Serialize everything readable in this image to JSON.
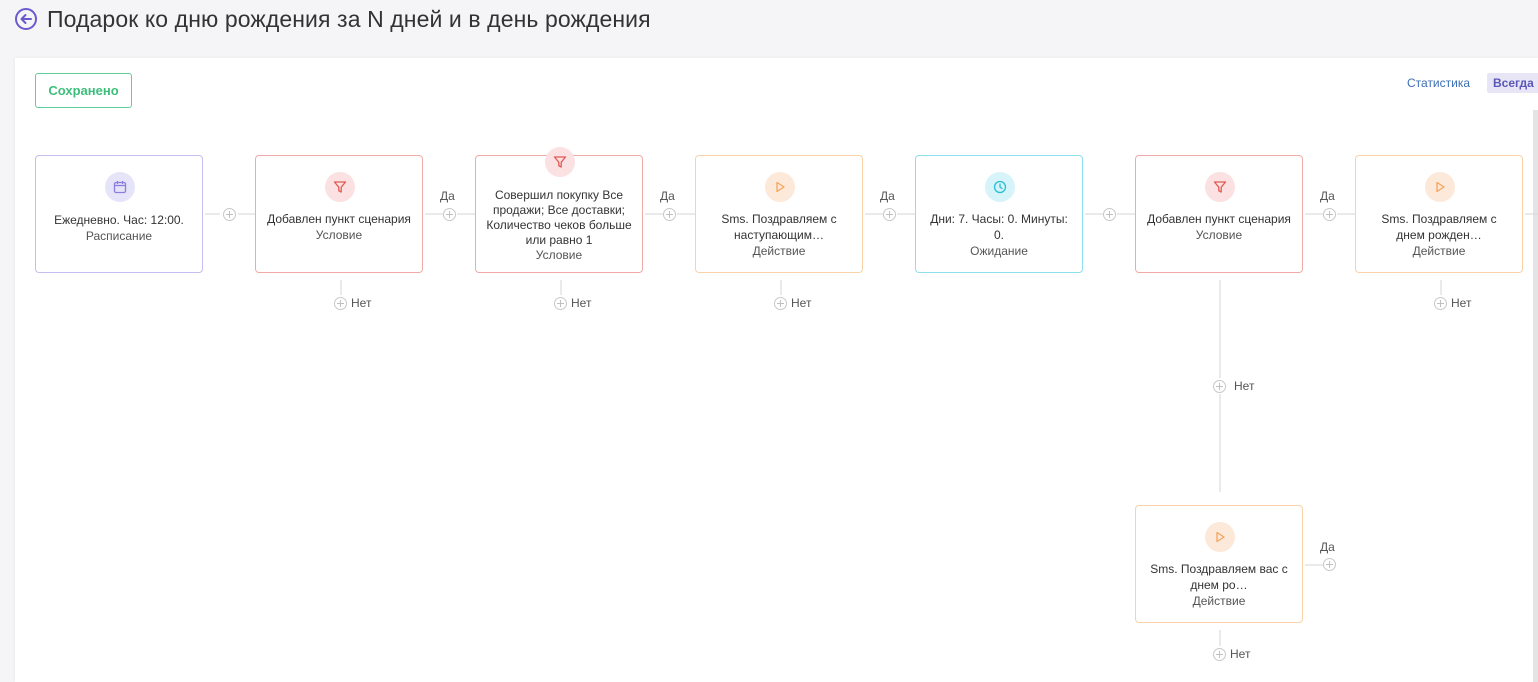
{
  "header": {
    "title": "Подарок ко дню рождения за N дней и в день рождения",
    "back_icon": "arrow-left-circle-icon"
  },
  "toolbar": {
    "saved_label": "Сохранено",
    "stats_label": "Статистика",
    "period_label": "Всегда"
  },
  "colors": {
    "accent": "#6a5acd",
    "saved_green": "#3dbf7b",
    "condition_red": "#e05a55",
    "action_orange": "#f4a55c",
    "wait_cyan": "#2bbdd6",
    "schedule_purple": "#8a7fe0"
  },
  "nodes": {
    "schedule": {
      "text": "Ежедневно. Час: 12:00.",
      "type": "Расписание",
      "icon": "calendar-icon"
    },
    "cond1": {
      "text": "Добавлен пункт сценария",
      "type": "Условие",
      "icon": "filter-icon"
    },
    "cond2": {
      "text": "Совершил покупку Все продажи; Все доставки; Количество чеков больше или равно 1",
      "type": "Условие",
      "icon": "filter-icon"
    },
    "action1": {
      "text": "Sms. Поздравляем с наступающим…",
      "type": "Действие",
      "icon": "play-icon"
    },
    "wait": {
      "text": "Дни: 7. Часы: 0. Минуты: 0.",
      "type": "Ожидание",
      "icon": "clock-icon"
    },
    "cond3": {
      "text": "Добавлен пункт сценария",
      "type": "Условие",
      "icon": "filter-icon"
    },
    "action2": {
      "text": "Sms. Поздравляем с днем рожден…",
      "type": "Действие",
      "icon": "play-icon"
    },
    "action3": {
      "text": "Sms. Поздравляем вас с днем ро…",
      "type": "Действие",
      "icon": "play-icon"
    }
  },
  "labels": {
    "yes": "Да",
    "no": "Нет"
  }
}
